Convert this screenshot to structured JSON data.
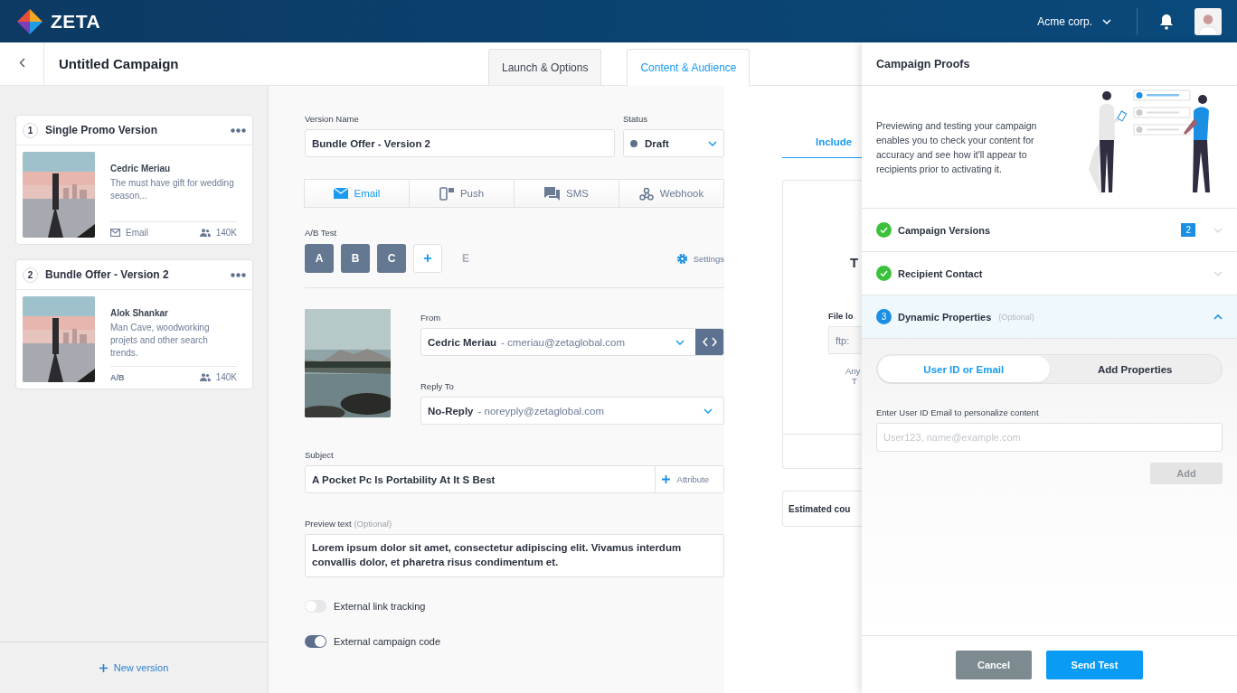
{
  "header": {
    "brand": "ZETA",
    "account": "Acme corp."
  },
  "subheader": {
    "title": "Untitled Campaign",
    "tabs": [
      {
        "label": "Launch & Options",
        "selected": false
      },
      {
        "label": "Content & Audience",
        "selected": true
      }
    ]
  },
  "versions": [
    {
      "number": "1",
      "title": "Single Promo Version",
      "author": "Cedric Meriau",
      "description": "The must have gift for wedding season...",
      "footer": {
        "kind": "email",
        "label": "Email"
      },
      "audience": "140K"
    },
    {
      "number": "2",
      "title": "Bundle Offer - Version 2",
      "author": "Alok Shankar",
      "description": "Man Cave, woodworking projets and other search trends.",
      "footer": {
        "kind": "ab",
        "label": "A/B"
      },
      "audience": "140K"
    }
  ],
  "new_version": "New version",
  "form": {
    "version_name": {
      "label": "Version Name",
      "value": "Bundle Offer - Version 2"
    },
    "status": {
      "label": "Status",
      "value": "Draft"
    },
    "channels": [
      {
        "kind": "email",
        "label": "Email",
        "selected": true
      },
      {
        "kind": "push",
        "label": "Push",
        "selected": false
      },
      {
        "kind": "sms",
        "label": "SMS",
        "selected": false
      },
      {
        "kind": "webhook",
        "label": "Webhook",
        "selected": false
      }
    ],
    "ab_test": {
      "label": "A/B Test",
      "variants": [
        {
          "kind": "variant",
          "label": "A"
        },
        {
          "kind": "variant",
          "label": "B"
        },
        {
          "kind": "variant",
          "label": "C"
        },
        {
          "kind": "add",
          "label": "+"
        },
        {
          "kind": "ghost",
          "label": "E"
        }
      ],
      "settings": "Settings"
    },
    "from": {
      "label": "From",
      "name": "Cedric Meriau",
      "email": "- cmeriau@zetaglobal.com"
    },
    "reply_to": {
      "label": "Reply To",
      "name": "No-Reply",
      "email": "- noreyply@zetaglobal.com"
    },
    "subject": {
      "label": "Subject",
      "value": "A Pocket Pc Is Portability At It S Best",
      "attribute": "Attribute"
    },
    "preview_text": {
      "label": "Preview text",
      "optional": "(Optional)",
      "value": "Lorem ipsum dolor sit amet, consectetur adipiscing elit. Vivamus interdum convallis dolor, et pharetra risus condimentum et."
    },
    "toggles": [
      {
        "label": "External link tracking",
        "on": false
      },
      {
        "label": "External campaign code",
        "on": true
      }
    ]
  },
  "audience": {
    "tab": "Include",
    "heading": "T",
    "file_label": "File lo",
    "file_value": "ftp:",
    "hint_lines": [
      "Any",
      "T"
    ],
    "estimate": "Estimated cou"
  },
  "proofs": {
    "title": "Campaign Proofs",
    "intro": "Previewing and testing your campaign enables you to check your content for accuracy and see how it'll appear to recipients prior to activating it.",
    "steps": [
      {
        "title": "Campaign Versions",
        "kind": "done",
        "badge": "2",
        "expanded": false
      },
      {
        "title": "Recipient Contact",
        "kind": "done",
        "expanded": false
      },
      {
        "title": "Dynamic Properties",
        "kind": "current",
        "number": "3",
        "optional": "(Optional)",
        "expanded": true
      }
    ],
    "segments": [
      {
        "label": "User ID or Email",
        "selected": true
      },
      {
        "label": "Add Properties",
        "selected": false
      }
    ],
    "input": {
      "label": "Enter User ID Email to personalize content",
      "placeholder": "User123, name@example.com"
    },
    "add_button": {
      "label": "Add",
      "disabled": true
    },
    "buttons": [
      {
        "kind": "secondary",
        "label": "Cancel"
      },
      {
        "kind": "primary",
        "label": "Send Test"
      }
    ]
  }
}
